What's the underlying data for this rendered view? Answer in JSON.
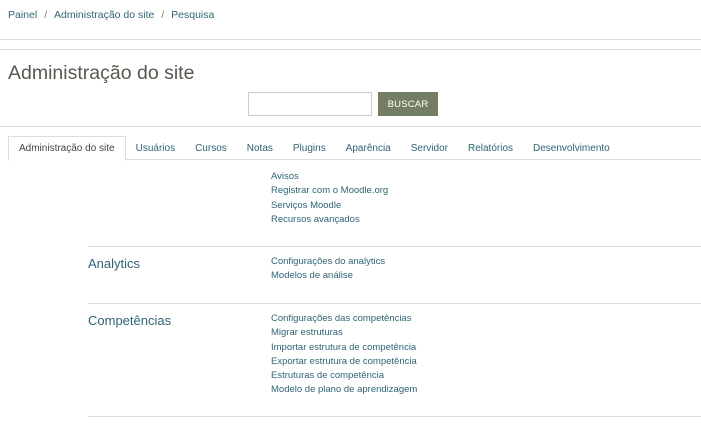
{
  "breadcrumb": {
    "items": [
      "Painel",
      "Administração do site",
      "Pesquisa"
    ],
    "separator": "/"
  },
  "page": {
    "title": "Administração do site"
  },
  "search": {
    "value": "",
    "placeholder": "",
    "button_label": "BUSCAR"
  },
  "tabs": [
    {
      "label": "Administração do site",
      "active": true
    },
    {
      "label": "Usuários",
      "active": false
    },
    {
      "label": "Cursos",
      "active": false
    },
    {
      "label": "Notas",
      "active": false
    },
    {
      "label": "Plugins",
      "active": false
    },
    {
      "label": "Aparência",
      "active": false
    },
    {
      "label": "Servidor",
      "active": false
    },
    {
      "label": "Relatórios",
      "active": false
    },
    {
      "label": "Desenvolvimento",
      "active": false
    }
  ],
  "sections": {
    "general": {
      "title": "",
      "links": [
        "Avisos",
        "Registrar com o Moodle.org",
        "Serviços Moodle",
        "Recursos avançados"
      ]
    },
    "analytics": {
      "title": "Analytics",
      "links": [
        "Configurações do analytics",
        "Modelos de análise"
      ]
    },
    "competencias": {
      "title": "Competências",
      "links": [
        "Configurações das competências",
        "Migrar estruturas",
        "Importar estrutura de competência",
        "Exportar estrutura de competência",
        "Estruturas de competência",
        "Modelo de plano de aprendizagem"
      ]
    }
  },
  "colors": {
    "link": "#2f6473",
    "button_bg": "#747e66",
    "title": "#555a4e",
    "divider": "#dddddd"
  }
}
